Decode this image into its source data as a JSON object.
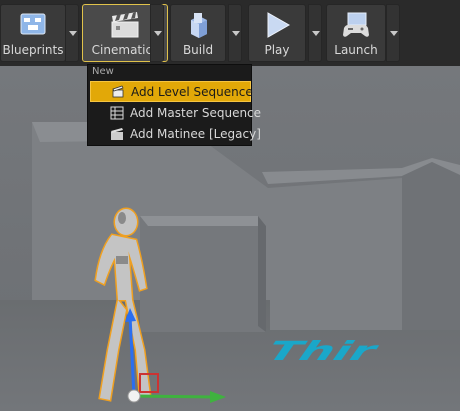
{
  "toolbar": {
    "buttons": [
      {
        "label": "Blueprints",
        "icon": "blueprints-icon"
      },
      {
        "label": "Cinematics",
        "icon": "clapperboard-icon",
        "active": true
      },
      {
        "label": "Build",
        "icon": "build-icon"
      },
      {
        "label": "Play",
        "icon": "play-icon"
      },
      {
        "label": "Launch",
        "icon": "launch-gamepad-icon"
      }
    ]
  },
  "menu": {
    "section_label": "New",
    "items": [
      {
        "label": "Add Level Sequence",
        "icon": "level-sequence-icon",
        "selected": true
      },
      {
        "label": "Add Master Sequence",
        "icon": "master-sequence-icon"
      },
      {
        "label": "Add Matinee [Legacy]",
        "icon": "matinee-icon"
      }
    ]
  },
  "viewport": {
    "floor_text": "Thir"
  },
  "colors": {
    "toolbar_bg": "#2a2a2a",
    "menu_bg": "#1b1b1b",
    "highlight": "#e2a808",
    "floor_text": "#1aa7c9",
    "selection_outline": "#f0a020"
  }
}
